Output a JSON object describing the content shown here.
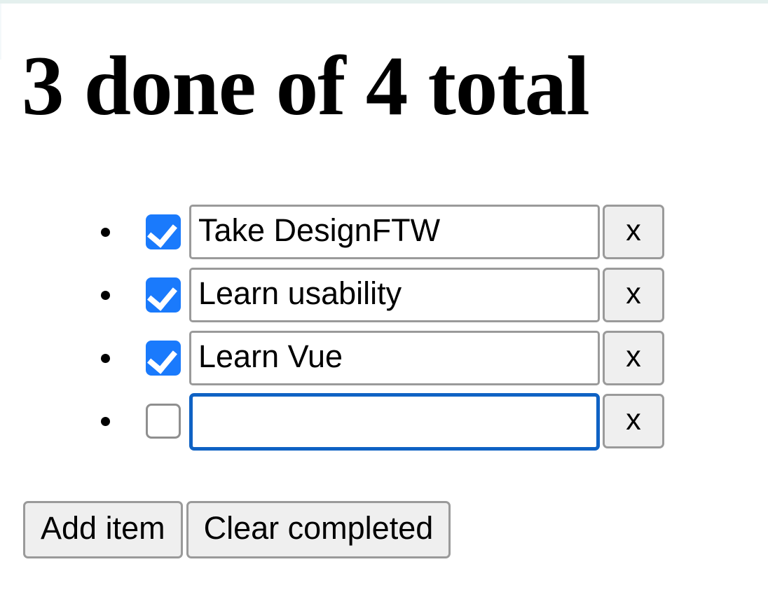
{
  "window": {
    "top_strip_color": "#e4f0ee",
    "background_color": "#ffffff"
  },
  "header": {
    "title": "3 done of 4 total",
    "done_count": 3,
    "total_count": 4
  },
  "todos": {
    "items": [
      {
        "label": "Take DesignFTW",
        "value": "Take DesignFTW",
        "placeholder": "",
        "checked": true,
        "focused": false,
        "delete_label": "x",
        "bullet": "•"
      },
      {
        "label": "Learn usability",
        "value": "Learn usability",
        "placeholder": "",
        "checked": true,
        "focused": false,
        "delete_label": "x",
        "bullet": "•"
      },
      {
        "label": "Learn Vue",
        "value": "Learn Vue",
        "placeholder": "",
        "checked": true,
        "focused": false,
        "delete_label": "x",
        "bullet": "•"
      },
      {
        "label": "",
        "value": "",
        "placeholder": "",
        "checked": false,
        "focused": true,
        "delete_label": "x",
        "bullet": "•"
      }
    ]
  },
  "actions": {
    "add_item_label": "Add item",
    "clear_completed_label": "Clear completed"
  },
  "colors": {
    "checkbox_checked": "#1a7afc",
    "checkbox_border": "#8f8f8f",
    "input_border": "#9a9a9a",
    "input_focus_border": "#0f62c4",
    "button_face": "#efefef",
    "text": "#000000"
  }
}
